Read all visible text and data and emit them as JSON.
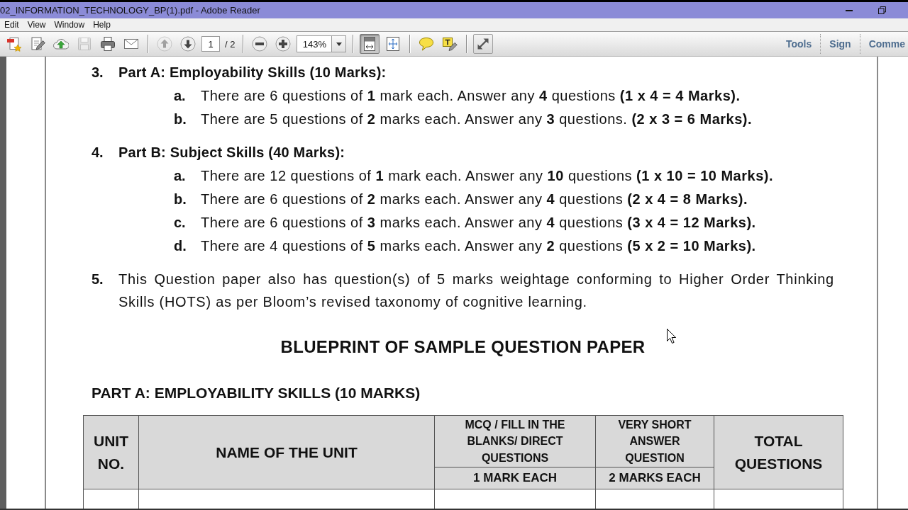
{
  "window": {
    "title": "02_INFORMATION_TECHNOLOGY_BP(1).pdf - Adobe Reader"
  },
  "menu": [
    "Edit",
    "View",
    "Window",
    "Help"
  ],
  "toolbar": {
    "groups": [
      {
        "items": [
          {
            "kind": "create",
            "disabled": false,
            "pressed": false
          },
          {
            "kind": "edit",
            "disabled": false,
            "pressed": false
          },
          {
            "kind": "upload",
            "disabled": false,
            "pressed": false
          },
          {
            "kind": "save",
            "disabled": true,
            "pressed": false
          },
          {
            "kind": "print",
            "disabled": false,
            "pressed": false
          },
          {
            "kind": "mail",
            "disabled": false,
            "pressed": false
          }
        ]
      },
      {
        "items": [
          {
            "kind": "prev",
            "disabled": true,
            "pressed": false
          },
          {
            "kind": "next",
            "disabled": false,
            "pressed": false
          },
          {
            "kind": "pagefield",
            "value": "1"
          },
          {
            "kind": "pagecount",
            "text": "/ 2"
          }
        ]
      },
      {
        "items": [
          {
            "kind": "zoomout",
            "disabled": false,
            "pressed": false
          },
          {
            "kind": "zoomin",
            "disabled": false,
            "pressed": false
          },
          {
            "kind": "zoomfield",
            "value": "143%"
          }
        ]
      },
      {
        "items": [
          {
            "kind": "fitpage",
            "disabled": false,
            "pressed": true
          },
          {
            "kind": "fitwidth",
            "disabled": false,
            "pressed": false
          }
        ]
      },
      {
        "items": [
          {
            "kind": "comment",
            "disabled": false,
            "pressed": false
          },
          {
            "kind": "highlight",
            "disabled": false,
            "pressed": false
          }
        ]
      },
      {
        "items": [
          {
            "kind": "fullscreen",
            "disabled": false,
            "pressed": false
          }
        ]
      }
    ],
    "panes": [
      "Tools",
      "Sign",
      "Comme"
    ]
  },
  "document": {
    "items": [
      {
        "kind": "section",
        "number": "3.",
        "heading": "Part A: Employability Skills (10 Marks):",
        "subitems": [
          {
            "letter": "a.",
            "text": "There are 6 questions of **1** mark each. Answer any **4** questions **(1 x 4 = 4 Marks).**"
          },
          {
            "letter": "b.",
            "text": "There are 5 questions of **2** marks each. Answer any **3** questions. **(2 x 3 = 6 Marks).**"
          }
        ]
      },
      {
        "kind": "section",
        "number": "4.",
        "heading": "Part B: Subject Skills (40 Marks):",
        "subitems": [
          {
            "letter": "a.",
            "text": "There are 12 questions of **1** mark each. Answer any **10** questions **(1 x 10 = 10 Marks).**"
          },
          {
            "letter": "b.",
            "text": "There are 6 questions of **2** marks each. Answer any **4** questions **(2 x 4 = 8 Marks).**"
          },
          {
            "letter": "c.",
            "text": "There are 6 questions of **3** marks each. Answer any **4** questions **(3 x 4 = 12 Marks).**"
          },
          {
            "letter": "d.",
            "text": "There are 4 questions of **5** marks each. Answer any **2** questions **(5 x 2 = 10 Marks).**"
          }
        ]
      },
      {
        "kind": "note",
        "number": "5.",
        "text": "This Question paper also has question(s) of 5 marks weightage conforming to Higher Order Thinking Skills (HOTS) as per Bloom’s revised taxonomy of cognitive learning."
      }
    ],
    "title": "BLUEPRINT OF SAMPLE QUESTION PAPER",
    "section_heading": "PART A: EMPLOYABILITY SKILLS (10 MARKS)",
    "table": {
      "columns": [
        {
          "label": "UNIT NO."
        },
        {
          "label": "NAME OF THE UNIT"
        },
        {
          "label": "MCQ / FILL IN THE BLANKS/ DIRECT QUESTIONS",
          "sub": "1 MARK EACH"
        },
        {
          "label": "VERY SHORT ANSWER QUESTION",
          "sub": "2 MARKS EACH"
        },
        {
          "label": "TOTAL QUESTIONS"
        }
      ]
    }
  }
}
